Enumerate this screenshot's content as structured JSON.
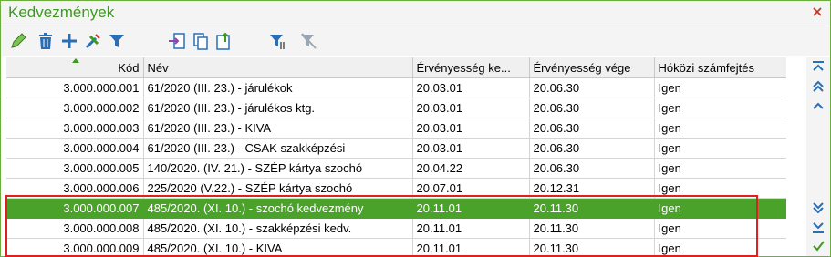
{
  "window": {
    "title": "Kedvezmények"
  },
  "toolbar": {
    "buttons": [
      {
        "name": "edit-icon"
      },
      {
        "name": "delete-icon"
      },
      {
        "name": "add-icon"
      },
      {
        "name": "tools-icon"
      },
      {
        "name": "filter-icon"
      },
      {
        "name": "import-icon"
      },
      {
        "name": "copy-icon"
      },
      {
        "name": "export-icon"
      },
      {
        "name": "filter-settings-icon"
      },
      {
        "name": "clear-filter-icon"
      }
    ]
  },
  "table": {
    "columns": [
      "Kód",
      "Név",
      "Érvényesség ke...",
      "Érvényesség vége",
      "Hóközi számfejtés"
    ],
    "rows": [
      {
        "kod": "3.000.000.001",
        "nev": "61/2020 (III. 23.) - járulékok",
        "kezdet": "20.03.01",
        "vege": "20.06.30",
        "hokozi": "Igen"
      },
      {
        "kod": "3.000.000.002",
        "nev": "61/2020 (III. 23.) - járulékos ktg.",
        "kezdet": "20.03.01",
        "vege": "20.06.30",
        "hokozi": "Igen"
      },
      {
        "kod": "3.000.000.003",
        "nev": "61/2020 (III. 23.) - KIVA",
        "kezdet": "20.03.01",
        "vege": "20.06.30",
        "hokozi": "Igen"
      },
      {
        "kod": "3.000.000.004",
        "nev": "61/2020 (III. 23.) - CSAK szakképzési",
        "kezdet": "20.03.01",
        "vege": "20.06.30",
        "hokozi": "Igen"
      },
      {
        "kod": "3.000.000.005",
        "nev": "140/2020. (IV. 21.) - SZÉP kártya szochó",
        "kezdet": "20.04.22",
        "vege": "20.06.30",
        "hokozi": "Igen"
      },
      {
        "kod": "3.000.000.006",
        "nev": "225/2020 (V.22.) - SZÉP kártya szochó",
        "kezdet": "20.07.01",
        "vege": "20.12.31",
        "hokozi": "Igen"
      },
      {
        "kod": "3.000.000.007",
        "nev": "485/2020. (XI. 10.) - szochó kedvezmény",
        "kezdet": "20.11.01",
        "vege": "20.11.30",
        "hokozi": "Igen"
      },
      {
        "kod": "3.000.000.008",
        "nev": "485/2020. (XI. 10.) - szakképzési kedv.",
        "kezdet": "20.11.01",
        "vege": "20.11.30",
        "hokozi": "Igen"
      },
      {
        "kod": "3.000.000.009",
        "nev": "485/2020. (XI. 10.) - KIVA",
        "kezdet": "20.11.01",
        "vege": "20.11.30",
        "hokozi": "Igen"
      }
    ],
    "selected_row": "3.000.000.007"
  },
  "nav": {
    "buttons": [
      "first-page-icon",
      "page-up-icon",
      "previous-icon",
      "next-icon",
      "last-page-icon",
      "confirm-icon"
    ]
  },
  "colors": {
    "accent": "#3c9a1f",
    "selected": "#4aa22a",
    "highlight": "#e02020"
  }
}
